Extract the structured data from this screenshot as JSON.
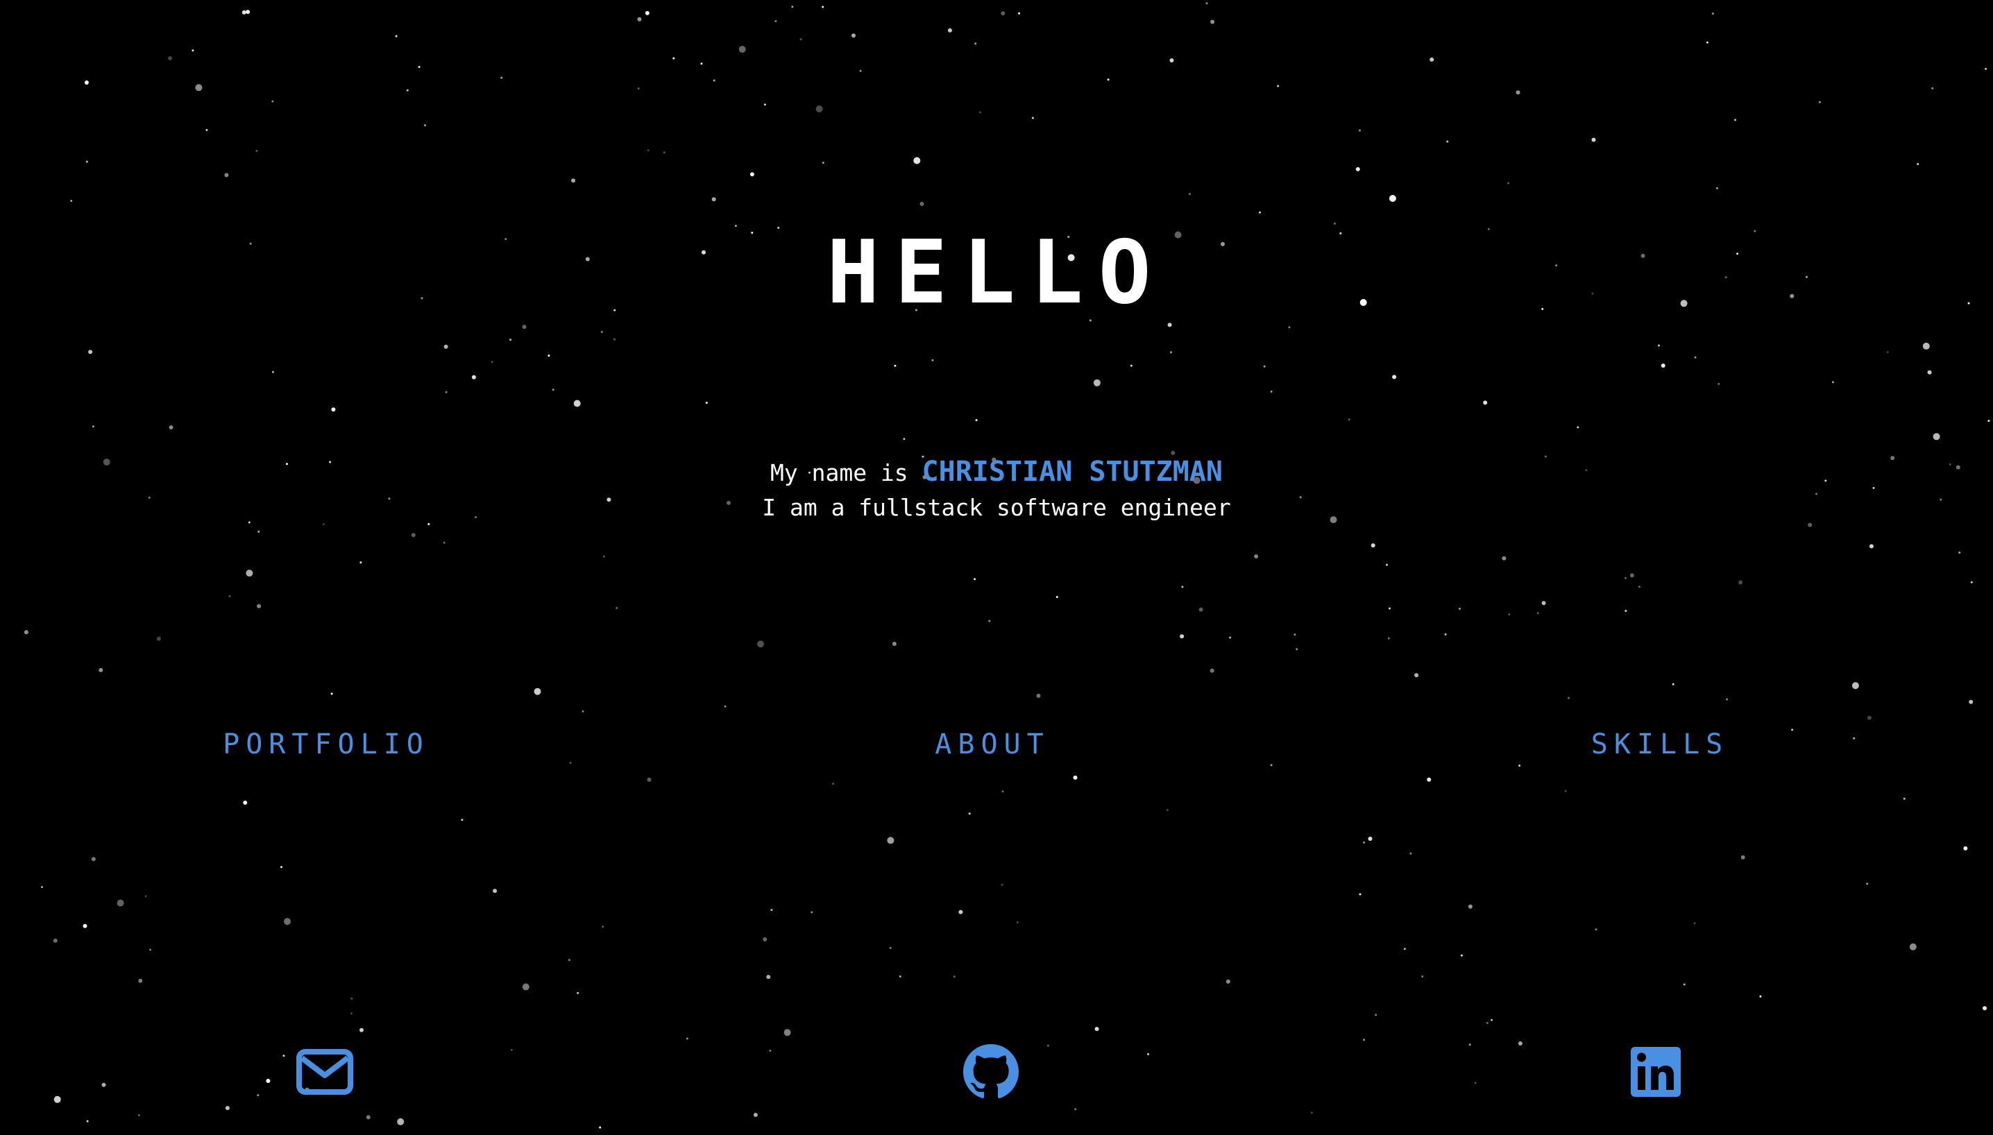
{
  "hero": {
    "title": "HELLO"
  },
  "intro": {
    "prefix": "My name is ",
    "name": "CHRISTIAN STUTZMAN",
    "tagline": "I am a fullstack software engineer"
  },
  "nav": {
    "items": [
      {
        "label": "PORTFOLIO"
      },
      {
        "label": "ABOUT"
      },
      {
        "label": "SKILLS"
      }
    ]
  },
  "social": {
    "items": [
      {
        "icon": "envelope-icon"
      },
      {
        "icon": "github-icon"
      },
      {
        "icon": "linkedin-icon"
      }
    ]
  },
  "colors": {
    "background": "#000000",
    "accent": "#4a90e2",
    "text": "#ffffff",
    "star": "#ffffff"
  }
}
